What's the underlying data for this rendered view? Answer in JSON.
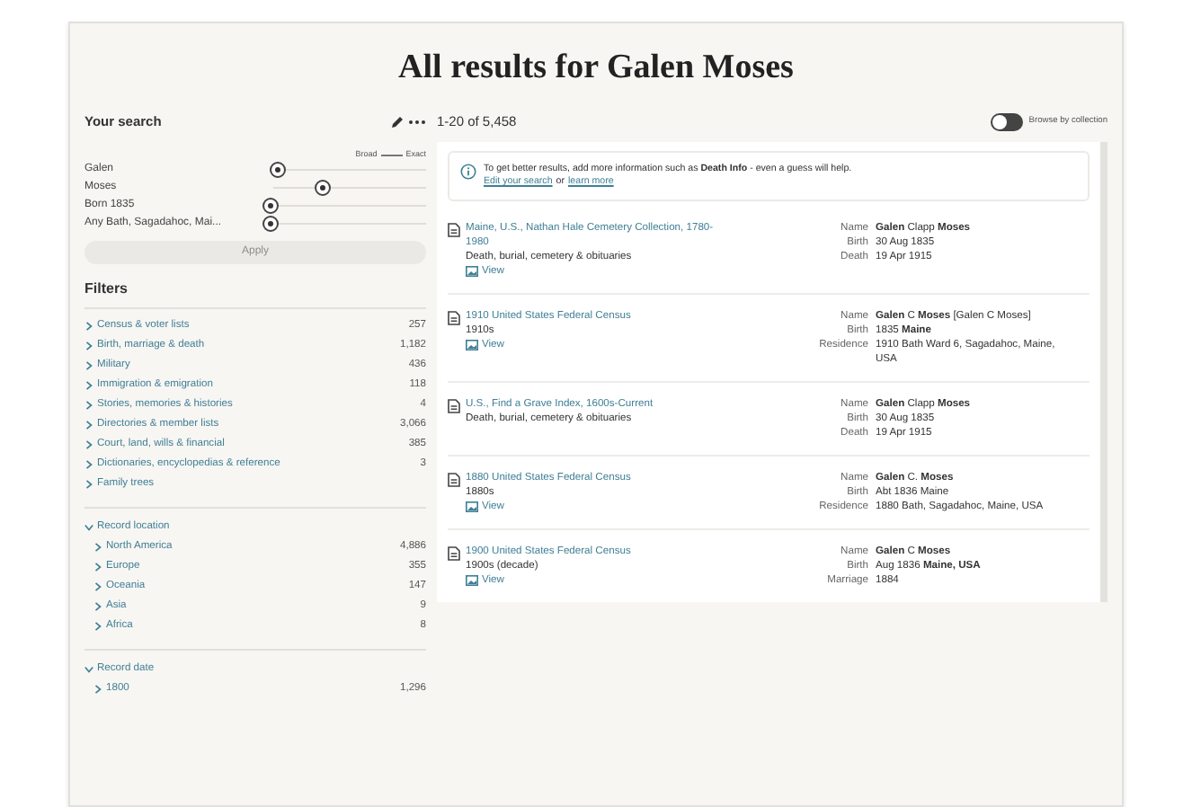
{
  "title": "All results for Galen Moses",
  "search": {
    "heading": "Your search",
    "scale_left": "Broad",
    "scale_right": "Exact",
    "terms": [
      {
        "label": "Galen",
        "level": 0.05
      },
      {
        "label": "Moses",
        "level": 0.35
      },
      {
        "label": "Born 1835",
        "level": 0.0
      },
      {
        "label": "Any Bath, Sagadahoc, Mai...",
        "level": 0.0
      }
    ],
    "apply": {
      "label": "Apply",
      "disabled": true
    }
  },
  "filters": {
    "heading": "Filters",
    "categories": [
      {
        "label": "Census & voter lists",
        "count": "257"
      },
      {
        "label": "Birth, marriage & death",
        "count": "1,182"
      },
      {
        "label": "Military",
        "count": "436"
      },
      {
        "label": "Immigration & emigration",
        "count": "118"
      },
      {
        "label": "Stories, memories & histories",
        "count": "4"
      },
      {
        "label": "Directories & member lists",
        "count": "3,066"
      },
      {
        "label": "Court, land, wills & financial",
        "count": "385"
      },
      {
        "label": "Dictionaries, encyclopedias & reference",
        "count": "3"
      },
      {
        "label": "Family trees"
      }
    ],
    "groups": [
      {
        "label": "Record location",
        "expanded": true,
        "children": [
          {
            "label": "North America",
            "count": "4,886"
          },
          {
            "label": "Europe",
            "count": "355"
          },
          {
            "label": "Oceania",
            "count": "147"
          },
          {
            "label": "Asia",
            "count": "9"
          },
          {
            "label": "Africa",
            "count": "8"
          }
        ]
      },
      {
        "label": "Record date",
        "expanded": true,
        "children": [
          {
            "label": "1800",
            "count": "1,296"
          }
        ]
      }
    ]
  },
  "results_count": "1-20 of 5,458",
  "browse_toggle": {
    "label": "Browse by collection",
    "on": false
  },
  "tip": {
    "text": "To get better results, add more information such as **Death Info** - even a guess will help.",
    "edit_link": "Edit your search",
    "or": "or",
    "learn_link": "learn more"
  },
  "records": [
    {
      "title": "Maine, U.S., Nathan Hale Cemetery Collection, 1780-1980",
      "lines": [
        "Death, burial, cemetery & obituaries"
      ],
      "view": "View",
      "fields": [
        {
          "label": "Name",
          "value": "**Galen** Clapp **Moses**"
        },
        {
          "label": "Birth",
          "value": "30 Aug 1835"
        },
        {
          "label": "Death",
          "value": "19 Apr 1915"
        }
      ]
    },
    {
      "title": "1910 United States Federal Census",
      "lines": [
        "1910s"
      ],
      "view": "View",
      "fields": [
        {
          "label": "Name",
          "value": "**Galen** C **Moses** [Galen C Moses]"
        },
        {
          "label": "Birth",
          "value": "1835 **Maine**"
        },
        {
          "label": "Residence",
          "value": "1910 Bath Ward 6, Sagadahoc, Maine, USA"
        }
      ]
    },
    {
      "title": "U.S., Find a Grave Index, 1600s-Current",
      "lines": [
        "Death, burial, cemetery & obituaries"
      ],
      "fields": [
        {
          "label": "Name",
          "value": "**Galen** Clapp **Moses**"
        },
        {
          "label": "Birth",
          "value": "30 Aug 1835"
        },
        {
          "label": "Death",
          "value": "19 Apr 1915"
        }
      ]
    },
    {
      "title": "1880 United States Federal Census",
      "lines": [
        "1880s"
      ],
      "view": "View",
      "fields": [
        {
          "label": "Name",
          "value": "**Galen** C. **Moses**"
        },
        {
          "label": "Birth",
          "value": "Abt 1836 Maine"
        },
        {
          "label": "Residence",
          "value": "1880 Bath, Sagadahoc, Maine, USA"
        }
      ]
    },
    {
      "title": "1900 United States Federal Census",
      "lines": [
        "1900s (decade)"
      ],
      "view": "View",
      "fields": [
        {
          "label": "Name",
          "value": "**Galen** C **Moses**"
        },
        {
          "label": "Birth",
          "value": "Aug 1836 **Maine, USA**"
        },
        {
          "label": "Marriage",
          "value": "1884"
        }
      ]
    }
  ]
}
